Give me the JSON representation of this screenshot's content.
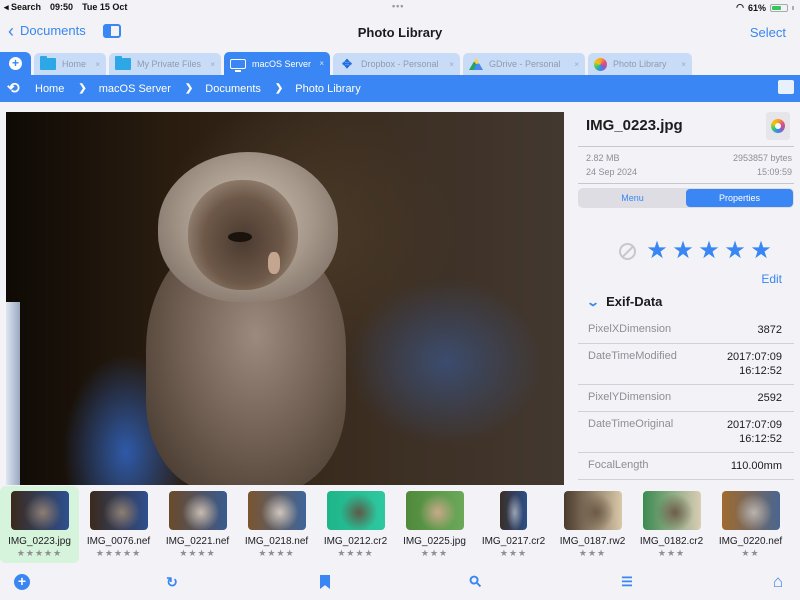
{
  "status_bar": {
    "back_app": "◂ Search",
    "time": "09:50",
    "date": "Tue 15 Oct",
    "battery_percent": "61%",
    "battery_level": 0.61
  },
  "nav": {
    "back_label": "Documents",
    "title": "Photo Library",
    "select_label": "Select"
  },
  "tabs": [
    {
      "label": "Home",
      "icon": "folder-icon",
      "active": false
    },
    {
      "label": "My Private Files",
      "icon": "folder-icon",
      "active": false
    },
    {
      "label": "macOS Server",
      "icon": "monitor-icon",
      "active": true
    },
    {
      "label": "Dropbox - Personal",
      "icon": "dropbox-icon",
      "active": false
    },
    {
      "label": "GDrive - Personal",
      "icon": "gdrive-icon",
      "active": false
    },
    {
      "label": "Photo Library",
      "icon": "photos-icon",
      "active": false
    }
  ],
  "tab_close_glyph": "×",
  "breadcrumbs": [
    "Home",
    "macOS Server",
    "Documents",
    "Photo Library"
  ],
  "breadcrumb_separator": "❯",
  "file_info": {
    "name": "IMG_0223.jpg",
    "size": "2.82 MB",
    "bytes": "2953857 bytes",
    "date": "24 Sep 2024",
    "time": "15:09:59"
  },
  "segments": [
    {
      "label": "Menu",
      "active": false
    },
    {
      "label": "Properties",
      "active": true
    }
  ],
  "rating": {
    "value": 5,
    "max": 5,
    "star_glyph": "★"
  },
  "edit_label": "Edit",
  "exif": {
    "title": "Exif-Data",
    "rows": [
      {
        "key": "PixelXDimension",
        "value": "3872"
      },
      {
        "key": "DateTimeModified",
        "value": "2017:07:09\n16:12:52"
      },
      {
        "key": "PixelYDimension",
        "value": "2592"
      },
      {
        "key": "DateTimeOriginal",
        "value": "2017:07:09\n16:12:52"
      },
      {
        "key": "FocalLength",
        "value": "110.00mm"
      }
    ]
  },
  "filmstrip": [
    {
      "name": "IMG_0223.jpg",
      "stars": 5,
      "selected": true,
      "colors": [
        "#3b2a1c",
        "#8d7f73",
        "#2e4f8f"
      ],
      "shape": "wide"
    },
    {
      "name": "IMG_0076.nef",
      "stars": 5,
      "selected": false,
      "colors": [
        "#3b2a1c",
        "#8d7f73",
        "#2e4f8f"
      ],
      "shape": "wide"
    },
    {
      "name": "IMG_0221.nef",
      "stars": 4,
      "selected": false,
      "colors": [
        "#6b4a2a",
        "#c8bcb0",
        "#3a5b8f"
      ],
      "shape": "wide"
    },
    {
      "name": "IMG_0218.nef",
      "stars": 4,
      "selected": false,
      "colors": [
        "#7a5530",
        "#cfc6bd",
        "#40659a"
      ],
      "shape": "wide"
    },
    {
      "name": "IMG_0212.cr2",
      "stars": 4,
      "selected": false,
      "colors": [
        "#1fb58a",
        "#5e5a48",
        "#2ec8a0"
      ],
      "shape": "wide"
    },
    {
      "name": "IMG_0225.jpg",
      "stars": 3,
      "selected": false,
      "colors": [
        "#4f8a3c",
        "#c9a98a",
        "#6ba85a"
      ],
      "shape": "wide"
    },
    {
      "name": "IMG_0217.cr2",
      "stars": 3,
      "selected": false,
      "colors": [
        "#3a2e28",
        "#9aa3b5",
        "#2c4f8a"
      ],
      "shape": "narrow"
    },
    {
      "name": "IMG_0187.rw2",
      "stars": 3,
      "selected": false,
      "colors": [
        "#4a3b2c",
        "#6c5a48",
        "#d9c8a8"
      ],
      "shape": "wide"
    },
    {
      "name": "IMG_0182.cr2",
      "stars": 3,
      "selected": false,
      "colors": [
        "#3c8a52",
        "#6f5e4b",
        "#d9cdb4"
      ],
      "shape": "wide"
    },
    {
      "name": "IMG_0220.nef",
      "stars": 2,
      "selected": false,
      "colors": [
        "#a06a2e",
        "#b8b3ad",
        "#4a6590"
      ],
      "shape": "wide"
    }
  ],
  "toolbar": {
    "add_glyph": "+",
    "reload_glyph": "↻",
    "search_glyph": "⚲",
    "sort_glyph": "☰",
    "home_glyph": "⌂"
  }
}
